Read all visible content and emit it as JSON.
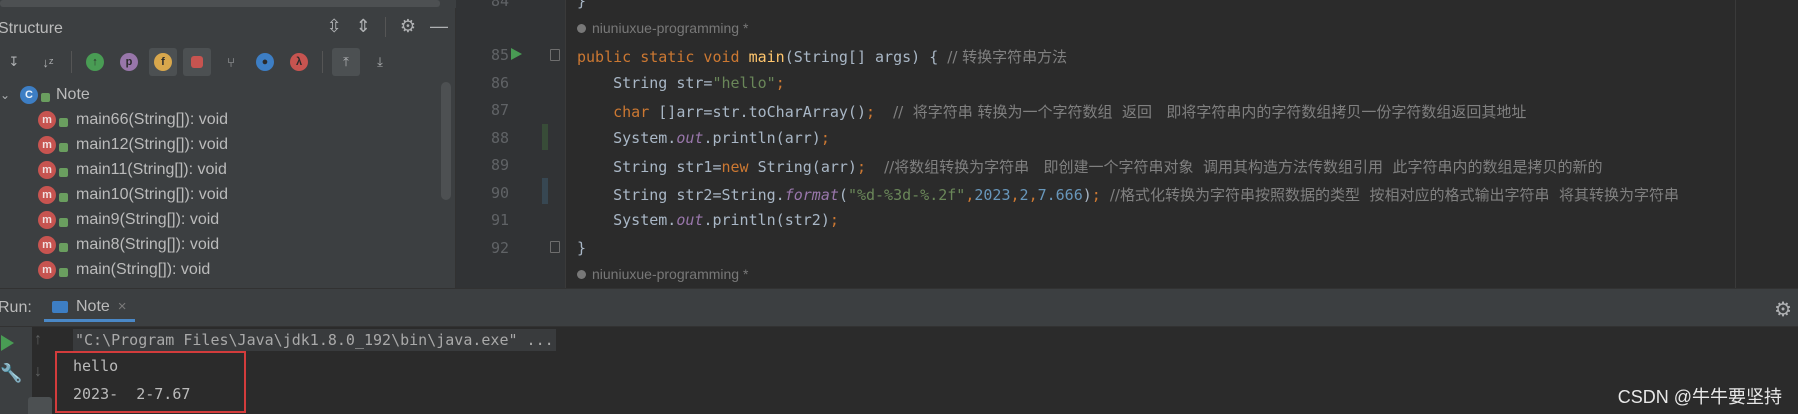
{
  "structure": {
    "title": "Structure",
    "toolbar": [
      "sort-visibility",
      "sort-alpha",
      "show-inherited",
      "show-properties",
      "show-fields",
      "show-non-public",
      "show-anonymous",
      "show-lambdas",
      "autoscroll-to-source",
      "autoscroll-from-source"
    ],
    "root": {
      "label": "Note"
    },
    "items": [
      {
        "label": "main66(String[]): void"
      },
      {
        "label": "main12(String[]): void"
      },
      {
        "label": "main11(String[]): void"
      },
      {
        "label": "main10(String[]): void"
      },
      {
        "label": "main9(String[]): void"
      },
      {
        "label": "main8(String[]): void"
      },
      {
        "label": "main(String[]): void"
      }
    ]
  },
  "editor": {
    "author_top": "niuniuxue-programming *",
    "author_bottom": "niuniuxue-programming *",
    "line_numbers": [
      "85",
      "86",
      "87",
      "88",
      "89",
      "90",
      "91",
      "92"
    ],
    "comments": {
      "l85": "// 转换字符串方法",
      "l87": "//  将字符串 转换为一个字符数组  返回   即将字符串内的字符数组拷贝一份字符数组返回其地址",
      "l89": "//将数组转换为字符串   即创建一个字符串对象  调用其构造方法传数组引用  此字符串内的数组是拷贝的新的",
      "l90": "//格式化转换为字符串按照数据的类型  按相对应的格式输出字符串  将其转换为字符串"
    }
  },
  "run": {
    "label": "Run:",
    "tab": "Note",
    "cmd": "\"C:\\Program Files\\Java\\jdk1.8.0_192\\bin\\java.exe\" ...",
    "output": [
      "hello",
      "2023-  2-7.67"
    ]
  },
  "watermark": "CSDN @牛牛要坚持",
  "colors": {
    "keyword": "#cc7832",
    "string": "#6a8759",
    "number": "#6897bb",
    "comment": "#808080",
    "function": "#ffc66d",
    "highlight_box": "#d33c3c"
  }
}
